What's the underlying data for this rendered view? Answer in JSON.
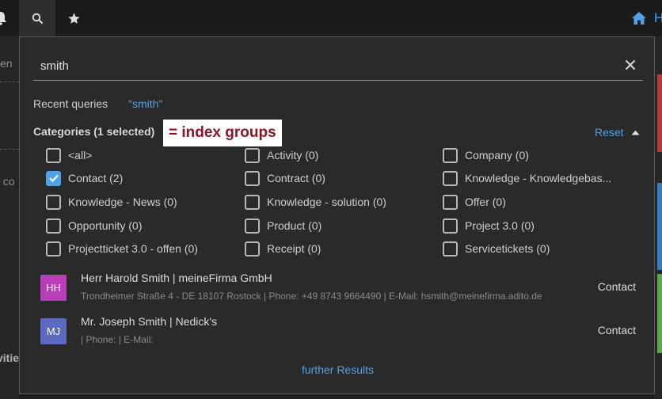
{
  "search": {
    "value": "smith"
  },
  "recent": {
    "label": "Recent queries",
    "queries": [
      "\"smith\""
    ]
  },
  "categories": {
    "title": "Categories (1 selected)",
    "reset_label": "Reset",
    "items": [
      {
        "label": "<all>",
        "checked": false
      },
      {
        "label": "Activity (0)",
        "checked": false
      },
      {
        "label": "Company (0)",
        "checked": false
      },
      {
        "label": "Contact (2)",
        "checked": true
      },
      {
        "label": "Contract (0)",
        "checked": false
      },
      {
        "label": "Knowledge - Knowledgebas...",
        "checked": false
      },
      {
        "label": "Knowledge - News (0)",
        "checked": false
      },
      {
        "label": "Knowledge - solution (0)",
        "checked": false
      },
      {
        "label": "Offer (0)",
        "checked": false
      },
      {
        "label": "Opportunity (0)",
        "checked": false
      },
      {
        "label": "Product (0)",
        "checked": false
      },
      {
        "label": "Project 3.0 (0)",
        "checked": false
      },
      {
        "label": "Projectticket 3.0 - offen (0)",
        "checked": false
      },
      {
        "label": "Receipt (0)",
        "checked": false
      },
      {
        "label": "Servicetickets (0)",
        "checked": false
      }
    ]
  },
  "annotation": "= index groups",
  "results": [
    {
      "initials": "HH",
      "avatar_color": "#b83fb8",
      "title": "Herr Harold Smith | meineFirma GmbH",
      "subtitle": "Trondheimer Straße 4 - DE 18107 Rostock | Phone: +49 8743 9664490 | E-Mail: hsmith@meinefirma.adito.de",
      "type": "Contact"
    },
    {
      "initials": "MJ",
      "avatar_color": "#5b6ac0",
      "title": "Mr. Joseph Smith | Nedick's",
      "subtitle": "| Phone: | E-Mail:",
      "type": "Contact"
    }
  ],
  "further_results": "further Results",
  "topbar": {
    "home_label": "H"
  },
  "background": {
    "left_fragments": [
      "en",
      "f co",
      "vitie"
    ]
  }
}
